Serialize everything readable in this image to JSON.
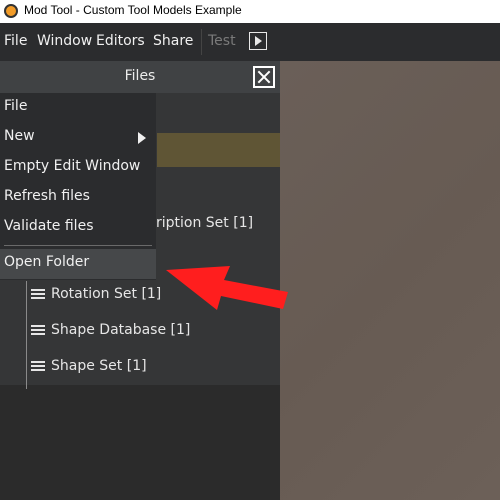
{
  "window": {
    "title": "Mod Tool - Custom Tool Models Example",
    "app_icon": "mod-tool-app-icon"
  },
  "menubar": {
    "items": [
      "File",
      "Window",
      "Editors",
      "Share"
    ],
    "test_label": "Test",
    "play_icon": "play-icon"
  },
  "panel": {
    "title": "Files",
    "close_icon": "close-icon",
    "obscured_text": "ription Set [1]",
    "tree": [
      {
        "label": "Rotation Set [1]",
        "icon": "list-icon"
      },
      {
        "label": "Shape Database [1]",
        "icon": "list-icon"
      },
      {
        "label": "Shape Set [1]",
        "icon": "list-icon"
      }
    ]
  },
  "context_menu": {
    "items": [
      {
        "label": "File"
      },
      {
        "label": "New",
        "icon": "submenu-arrow-icon"
      },
      {
        "label": "Empty Edit Window"
      },
      {
        "label": "Refresh files"
      },
      {
        "label": "Validate files"
      },
      {
        "label": "Open Folder"
      }
    ],
    "highlighted": "Open Folder"
  },
  "annotation": {
    "type": "arrow",
    "color": "#ff1e1e",
    "points_to": "Open Folder"
  },
  "colors": {
    "background": "#2b2b2b",
    "menubar": "#2b2c2e",
    "viewport": "#6a5f58",
    "accent_yellow": "#5f5535",
    "arrow": "#ff1e1e"
  }
}
